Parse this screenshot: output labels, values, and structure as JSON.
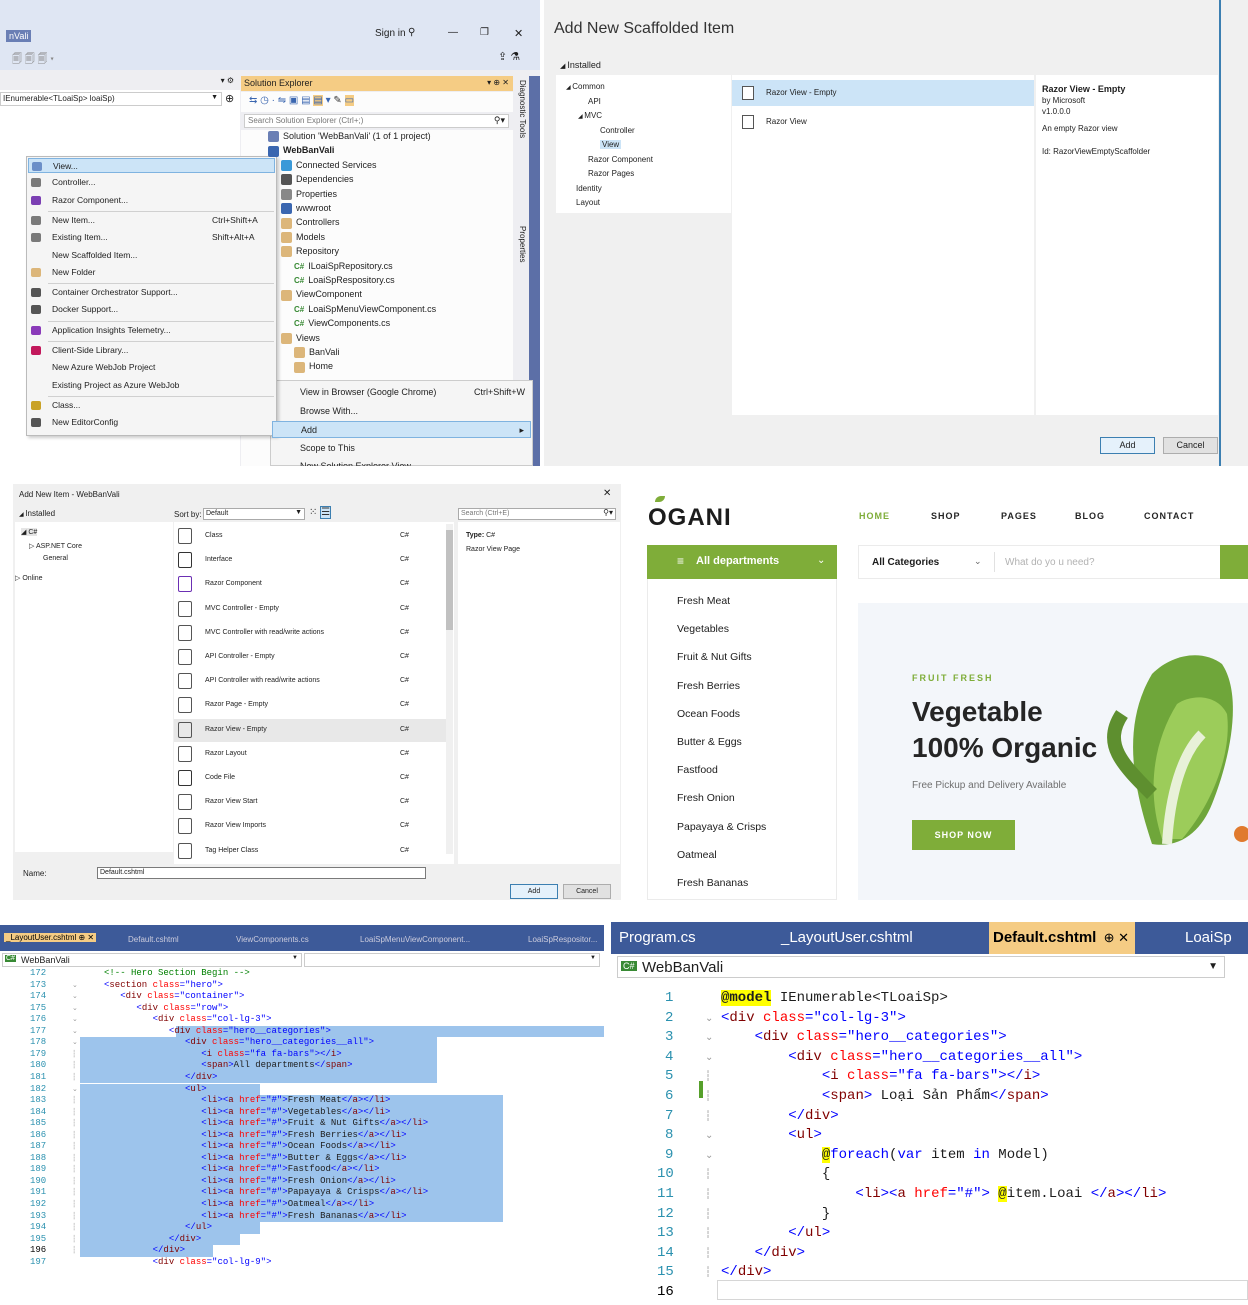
{
  "vs": {
    "title": "WebBanVali",
    "title_short": "nVali",
    "signin": "Sign in",
    "left_combo": "IEnumerable<TLoaiSp> loaiSp)",
    "se_title": "Solution Explorer",
    "se_search": "Search Solution Explorer (Ctrl+;)",
    "side_tabs": [
      "Diagnostic Tools",
      "Properties"
    ],
    "tree": [
      {
        "t": "Solution 'WebBanVali' (1 of 1 project)",
        "i": "solution",
        "d": 0
      },
      {
        "t": "WebBanVali",
        "i": "project",
        "d": 0,
        "b": true
      },
      {
        "t": "Connected Services",
        "i": "service",
        "d": 1
      },
      {
        "t": "Dependencies",
        "i": "deps",
        "d": 1
      },
      {
        "t": "Properties",
        "i": "props",
        "d": 1
      },
      {
        "t": "wwwroot",
        "i": "globe",
        "d": 1
      },
      {
        "t": "Controllers",
        "i": "folder",
        "d": 1
      },
      {
        "t": "Models",
        "i": "folder",
        "d": 1
      },
      {
        "t": "Repository",
        "i": "folder",
        "d": 1
      },
      {
        "t": "ILoaiSpRepository.cs",
        "i": "cs",
        "d": 2
      },
      {
        "t": "LoaiSpRespository.cs",
        "i": "cs",
        "d": 2
      },
      {
        "t": "ViewComponent",
        "i": "folder",
        "d": 1
      },
      {
        "t": "LoaiSpMenuViewComponent.cs",
        "i": "cs",
        "d": 2
      },
      {
        "t": "ViewComponents.cs",
        "i": "cs",
        "d": 2
      },
      {
        "t": "Views",
        "i": "folder",
        "d": 1
      },
      {
        "t": "BanVali",
        "i": "folder",
        "d": 2
      },
      {
        "t": "Home",
        "i": "folder",
        "d": 2
      }
    ],
    "add_menu": [
      {
        "l": "View...",
        "k": "",
        "c": "#6b8fc8"
      },
      {
        "l": "Controller...",
        "k": "",
        "c": "#7a7a7a"
      },
      {
        "l": "Razor Component...",
        "k": "",
        "c": "#7b3fb3"
      },
      {
        "l": "New Item...",
        "k": "Ctrl+Shift+A",
        "c": "#7a7a7a",
        "sep": true
      },
      {
        "l": "Existing Item...",
        "k": "Shift+Alt+A",
        "c": "#7a7a7a"
      },
      {
        "l": "New Scaffolded Item...",
        "k": "",
        "c": ""
      },
      {
        "l": "New Folder",
        "k": "",
        "c": "#dcb67a"
      },
      {
        "l": "Container Orchestrator Support...",
        "k": "",
        "c": "#555",
        "sep": true
      },
      {
        "l": "Docker Support...",
        "k": "",
        "c": "#555"
      },
      {
        "l": "Application Insights Telemetry...",
        "k": "",
        "c": "#8a3ab9",
        "sep": true
      },
      {
        "l": "Client-Side Library...",
        "k": "",
        "c": "#c2185b",
        "sep": true
      },
      {
        "l": "New Azure WebJob Project",
        "k": "",
        "c": ""
      },
      {
        "l": "Existing Project as Azure WebJob",
        "k": "",
        "c": ""
      },
      {
        "l": "Class...",
        "k": "",
        "c": "#c9a227",
        "sep": true
      },
      {
        "l": "New EditorConfig",
        "k": "",
        "c": "#555"
      }
    ],
    "ctx_menu": [
      {
        "l": "View in Browser (Google Chrome)",
        "k": "Ctrl+Shift+W"
      },
      {
        "l": "Browse With...",
        "k": ""
      },
      {
        "l": "Add",
        "k": "▸"
      },
      {
        "l": "Scope to This",
        "k": ""
      },
      {
        "l": "New Solution Explorer View",
        "k": ""
      }
    ]
  },
  "scaffold": {
    "title": "Add New Scaffolded Item",
    "installed": "Installed",
    "tree": [
      {
        "t": "Common",
        "d": 0,
        "arrow": "◢"
      },
      {
        "t": "API",
        "d": 1
      },
      {
        "t": "MVC",
        "d": 1,
        "arrow": "◢"
      },
      {
        "t": "Controller",
        "d": 2
      },
      {
        "t": "View",
        "d": 2,
        "sel": true
      },
      {
        "t": "Razor Component",
        "d": 1
      },
      {
        "t": "Razor Pages",
        "d": 1
      },
      {
        "t": "Identity",
        "d": 0
      },
      {
        "t": "Layout",
        "d": 0
      }
    ],
    "items": [
      "Razor View - Empty",
      "Razor View"
    ],
    "detail": {
      "name": "Razor View - Empty",
      "by": "by Microsoft",
      "ver": "v1.0.0.0",
      "desc": "An empty Razor view",
      "id": "Id: RazorViewEmptyScaffolder"
    },
    "add": "Add",
    "cancel": "Cancel"
  },
  "newitem": {
    "title": "Add New Item - WebBanVali",
    "installed": "Installed",
    "tree": [
      {
        "t": "C#",
        "d": 0
      },
      {
        "t": "ASP.NET Core",
        "d": 1
      },
      {
        "t": "General",
        "d": 2
      },
      {
        "t": "Online",
        "d": 0
      }
    ],
    "sort_label": "Sort by:",
    "sort_value": "Default",
    "search": "Search (Ctrl+E)",
    "items": [
      "Class",
      "Interface",
      "Razor Component",
      "MVC Controller - Empty",
      "MVC Controller with read/write actions",
      "API Controller - Empty",
      "API Controller with read/write actions",
      "Razor Page - Empty",
      "Razor View - Empty",
      "Razor Layout",
      "Code File",
      "Razor View Start",
      "Razor View Imports",
      "Tag Helper Class"
    ],
    "lang": "C#",
    "selected": 8,
    "type_label": "Type:",
    "type_value": "C#",
    "type_desc": "Razor View Page",
    "name_label": "Name:",
    "name_value": "Default.cshtml",
    "add": "Add",
    "cancel": "Cancel"
  },
  "ogani": {
    "logo": "OGANI",
    "nav": [
      "HOME",
      "SHOP",
      "PAGES",
      "BLOG",
      "CONTACT"
    ],
    "all_dept": "All departments",
    "cat_select": "All Categories",
    "search_ph": "What do yo u need?",
    "cats": [
      "Fresh Meat",
      "Vegetables",
      "Fruit & Nut Gifts",
      "Fresh Berries",
      "Ocean Foods",
      "Butter & Eggs",
      "Fastfood",
      "Fresh Onion",
      "Papayaya & Crisps",
      "Oatmeal",
      "Fresh Bananas"
    ],
    "hero_tag": "FRUIT FRESH",
    "hero_l1": "Vegetable",
    "hero_l2": "100% Organic",
    "hero_sub": "Free Pickup and Delivery Available",
    "hero_btn": "SHOP NOW",
    "colors": {
      "green": "#7fad39",
      "dark": "#1c1c1c"
    }
  },
  "code1": {
    "tabs": [
      "_LayoutUser.cshtml",
      "Default.cshtml",
      "ViewComponents.cs",
      "LoaiSpMenuViewComponent...",
      "LoaiSpRespositor..."
    ],
    "combo": "WebBanVali",
    "lines": [
      "172",
      "173",
      "174",
      "175",
      "176",
      "177",
      "178",
      "179",
      "180",
      "181",
      "182",
      "183",
      "184",
      "185",
      "186",
      "187",
      "188",
      "189",
      "190",
      "191",
      "192",
      "193",
      "194",
      "195",
      "196",
      "197"
    ],
    "cats": [
      "Fresh Meat",
      "Vegetables",
      "Fruit & Nut Gifts",
      "Fresh Berries",
      "Ocean Foods",
      "Butter & Eggs",
      "Fastfood",
      "Fresh Onion",
      "Papayaya & Crisps",
      "Oatmeal",
      "Fresh Bananas"
    ],
    "comment": "<!-- Hero Section Begin -->",
    "dept": "All departments"
  },
  "code2": {
    "tabs": [
      "Program.cs",
      "_LayoutUser.cshtml",
      "Default.cshtml",
      "LoaiSp"
    ],
    "combo": "WebBanVali",
    "lines": [
      "1",
      "2",
      "3",
      "4",
      "5",
      "6",
      "7",
      "8",
      "9",
      "10",
      "11",
      "12",
      "13",
      "14",
      "15",
      "16"
    ],
    "model_kw": "@model",
    "model_type": " IEnumerable<TLoaiSp>",
    "span_text": " Loại Sản Phẩm"
  }
}
